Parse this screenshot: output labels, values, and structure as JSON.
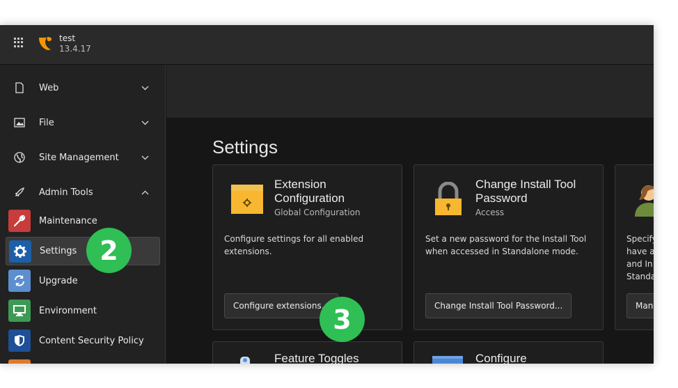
{
  "topbar": {
    "site_name": "test",
    "site_version": "13.4.17"
  },
  "sidebar": {
    "groups": [
      {
        "label": "Web",
        "icon": "page-icon"
      },
      {
        "label": "File",
        "icon": "image-icon"
      },
      {
        "label": "Site Management",
        "icon": "globe-icon"
      },
      {
        "label": "Admin Tools",
        "icon": "rocket-icon"
      }
    ],
    "modules": [
      {
        "label": "Maintenance",
        "icon": "wrench-icon",
        "color": "#c83c3c"
      },
      {
        "label": "Settings",
        "icon": "gear-icon",
        "color": "#1d5ea8"
      },
      {
        "label": "Upgrade",
        "icon": "refresh-icon",
        "color": "#5d8fd0"
      },
      {
        "label": "Environment",
        "icon": "monitor-icon",
        "color": "#3d9a55"
      },
      {
        "label": "Content Security Policy",
        "icon": "shield-icon",
        "color": "#1f4f96"
      }
    ]
  },
  "main": {
    "title": "Settings",
    "cards": [
      {
        "title": "Extension Configuration",
        "subtitle": "Global Configuration",
        "description": "Configure settings for all enabled extensions.",
        "button": "Configure extensions...",
        "icon": "box-icon"
      },
      {
        "title": "Change Install Tool Password",
        "subtitle": "Access",
        "description": "Set a new password for the Install Tool when accessed in Standalone mode.",
        "button": "Change Install Tool Password...",
        "icon": "lock-icon"
      },
      {
        "title": "",
        "description_lines": [
          "Specify",
          "have a",
          "and In",
          "Standa"
        ],
        "button": "Mana",
        "icon": "users-icon"
      }
    ],
    "bottom_cards": [
      {
        "title": "Feature Toggles"
      },
      {
        "title": "Configure"
      }
    ]
  },
  "annotations": {
    "step_a": "2",
    "step_b": "3",
    "color": "#2fbf55"
  }
}
